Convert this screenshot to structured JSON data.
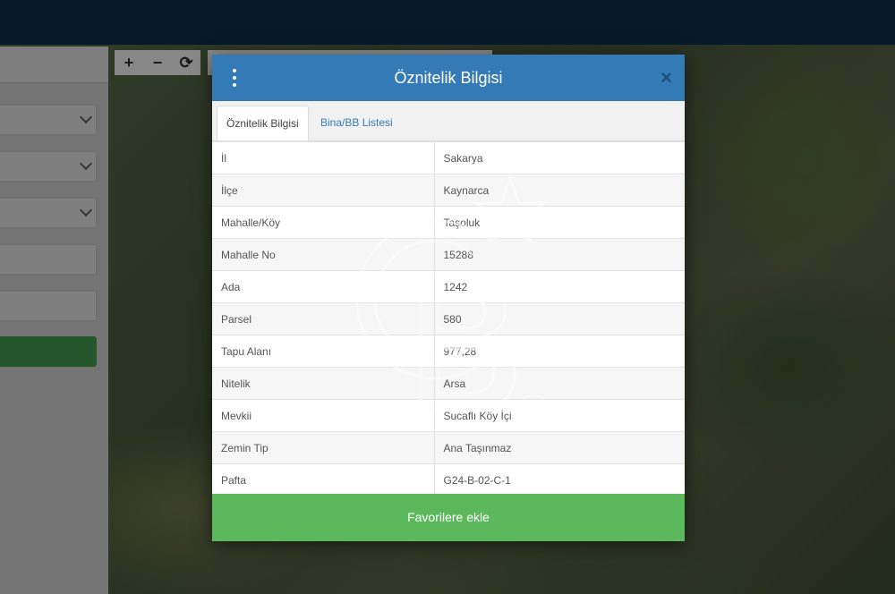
{
  "modal": {
    "title": "Öznitelik Bilgisi",
    "close_glyph": "×",
    "tabs": [
      {
        "label": "Öznitelik Bilgisi",
        "active": true
      },
      {
        "label": "Bina/BB Listesi",
        "active": false
      }
    ],
    "rows": [
      {
        "key": "İl",
        "value": "Sakarya"
      },
      {
        "key": "İlçe",
        "value": "Kaynarca"
      },
      {
        "key": "Mahalle/Köy",
        "value": "Taşoluk"
      },
      {
        "key": "Mahalle No",
        "value": "15288"
      },
      {
        "key": "Ada",
        "value": "1242"
      },
      {
        "key": "Parsel",
        "value": "580"
      },
      {
        "key": "Tapu Alanı",
        "value": "977,28"
      },
      {
        "key": "Nitelik",
        "value": "Arsa"
      },
      {
        "key": "Mevkii",
        "value": "Sucaflı Köy İçi"
      },
      {
        "key": "Zemin Tip",
        "value": "Ana Taşınmaz"
      },
      {
        "key": "Pafta",
        "value": "G24-B-02-C-1"
      }
    ],
    "favorite_button": "Favorilere ekle"
  },
  "map_tools": {
    "zoom_in": "+",
    "zoom_out": "−",
    "refresh": "⟳"
  },
  "watermark": {
    "letters": "CB",
    "mark": "SM"
  },
  "colors": {
    "header": "#337ab7",
    "favorite": "#5cb85c",
    "topbar": "#07182a"
  },
  "icons": [
    "kebab-menu-icon",
    "close-icon",
    "zoom-in-icon",
    "zoom-out-icon",
    "refresh-icon",
    "chevron-down-icon"
  ]
}
